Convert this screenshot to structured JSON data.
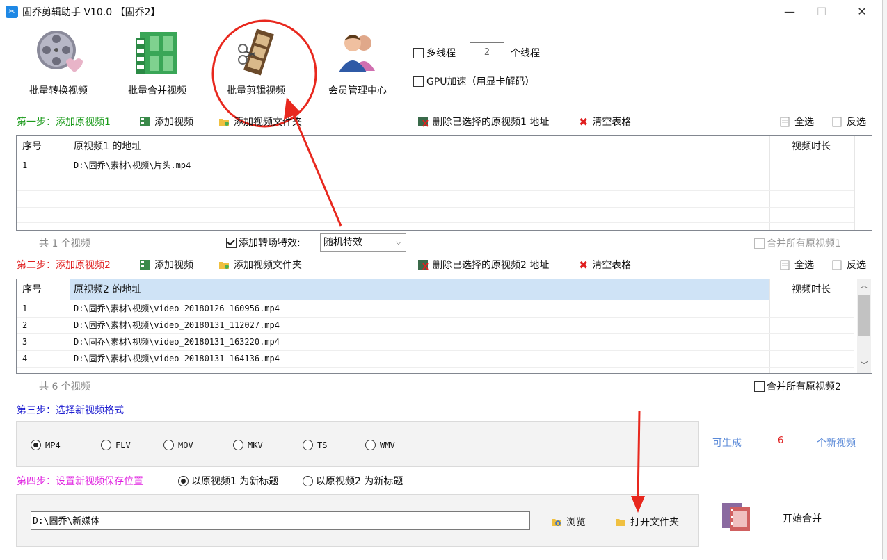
{
  "window": {
    "title": "固乔剪辑助手 V10.0 【固乔2】",
    "minimize": "—",
    "maximize": "☐",
    "close": "✕"
  },
  "toolbar": {
    "items": [
      {
        "label": "批量转换视频",
        "icon": "film-reel-heart-icon"
      },
      {
        "label": "批量合并视频",
        "icon": "film-merge-icon"
      },
      {
        "label": "批量剪辑视频",
        "icon": "film-cut-icon"
      },
      {
        "label": "会员管理中心",
        "icon": "users-icon"
      }
    ],
    "multithread_label": "多线程",
    "multithread_checked": false,
    "thread_count": "2",
    "thread_unit": "个线程",
    "gpu_label": "GPU加速（用显卡解码）",
    "gpu_checked": false
  },
  "step1": {
    "title": "第一步：添加原视频1",
    "color": "#1a9a1a",
    "add_video": "添加视频",
    "add_folder": "添加视频文件夹",
    "delete_selected": "删除已选择的原视频1 地址",
    "clear_table": "清空表格",
    "select_all": "全选",
    "invert": "反选",
    "columns": [
      "序号",
      "原视频1 的地址",
      "视频时长"
    ],
    "rows": [
      {
        "no": "1",
        "path": "D:\\固乔\\素材\\视频\\片头.mp4",
        "duration": ""
      }
    ],
    "count_text": "共 1 个视频",
    "transition_label": "添加转场特效:",
    "transition_checked": true,
    "transition_value": "随机特效",
    "merge_all_label": "合并所有原视频1",
    "merge_all_checked": false
  },
  "step2": {
    "title": "第二步：添加原视频2",
    "color": "#e02020",
    "add_video": "添加视频",
    "add_folder": "添加视频文件夹",
    "delete_selected": "删除已选择的原视频2 地址",
    "clear_table": "清空表格",
    "select_all": "全选",
    "invert": "反选",
    "columns": [
      "序号",
      "原视频2 的地址",
      "视频时长"
    ],
    "rows": [
      {
        "no": "1",
        "path": "D:\\固乔\\素材\\视频\\video_20180126_160956.mp4",
        "duration": ""
      },
      {
        "no": "2",
        "path": "D:\\固乔\\素材\\视频\\video_20180131_112027.mp4",
        "duration": ""
      },
      {
        "no": "3",
        "path": "D:\\固乔\\素材\\视频\\video_20180131_163220.mp4",
        "duration": ""
      },
      {
        "no": "4",
        "path": "D:\\固乔\\素材\\视频\\video_20180131_164136.mp4",
        "duration": ""
      }
    ],
    "count_text": "共 6 个视频",
    "merge_all_label": "合并所有原视频2",
    "merge_all_checked": false
  },
  "step3": {
    "title": "第三步：选择新视频格式",
    "color": "#1a1ad0",
    "formats": [
      "MP4",
      "FLV",
      "MOV",
      "MKV",
      "TS",
      "WMV"
    ],
    "selected": "MP4",
    "can_generate": "可生成",
    "count": "6",
    "new_videos": "个新视频"
  },
  "step4": {
    "title": "第四步：设置新视频保存位置",
    "color": "#e020e0",
    "option1": "以原视频1 为新标题",
    "option2": "以原视频2 为新标题",
    "selected_option": 1,
    "save_path": "D:\\固乔\\新媒体",
    "browse": "浏览",
    "open_folder": "打开文件夹",
    "start_merge": "开始合并"
  }
}
